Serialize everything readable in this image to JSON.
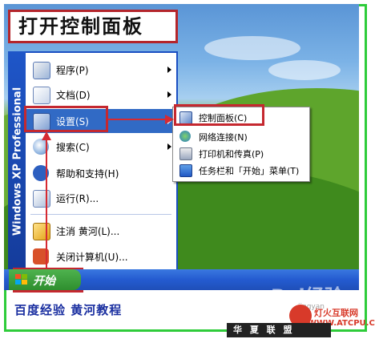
{
  "title_box": "打开控制面板",
  "sidebar_brand": "Windows XP Professional",
  "start_menu": {
    "items": [
      {
        "label": "程序(P)",
        "icon": "programs-icon"
      },
      {
        "label": "文档(D)",
        "icon": "documents-icon"
      },
      {
        "label": "设置(S)",
        "icon": "settings-icon"
      },
      {
        "label": "搜索(C)",
        "icon": "search-icon"
      },
      {
        "label": "帮助和支持(H)",
        "icon": "help-icon"
      },
      {
        "label": "运行(R)...",
        "icon": "run-icon"
      },
      {
        "label": "注消 黄河(L)...",
        "icon": "logoff-icon"
      },
      {
        "label": "关闭计算机(U)...",
        "icon": "shutdown-icon"
      }
    ]
  },
  "settings_submenu": {
    "items": [
      {
        "label": "控制面板(C)",
        "icon": "control-panel-icon"
      },
      {
        "label": "网络连接(N)",
        "icon": "network-icon"
      },
      {
        "label": "打印机和传真(P)",
        "icon": "printer-icon"
      },
      {
        "label": "任务栏和「开始」菜单(T)",
        "icon": "taskbar-icon"
      }
    ]
  },
  "taskbar": {
    "start_label": "开始"
  },
  "caption": "百度经验   黄河教程",
  "watermarks": {
    "baidu": "Bai经验",
    "baidu_sub": "jingyan",
    "hx": "华 夏 联 盟",
    "logo_line1": "灯火互联网",
    "logo_line2": "WWW.ATCPU.COM"
  },
  "colors": {
    "highlight": "#c5282f",
    "frame": "#2ecc3a",
    "selection": "#316ac5"
  }
}
